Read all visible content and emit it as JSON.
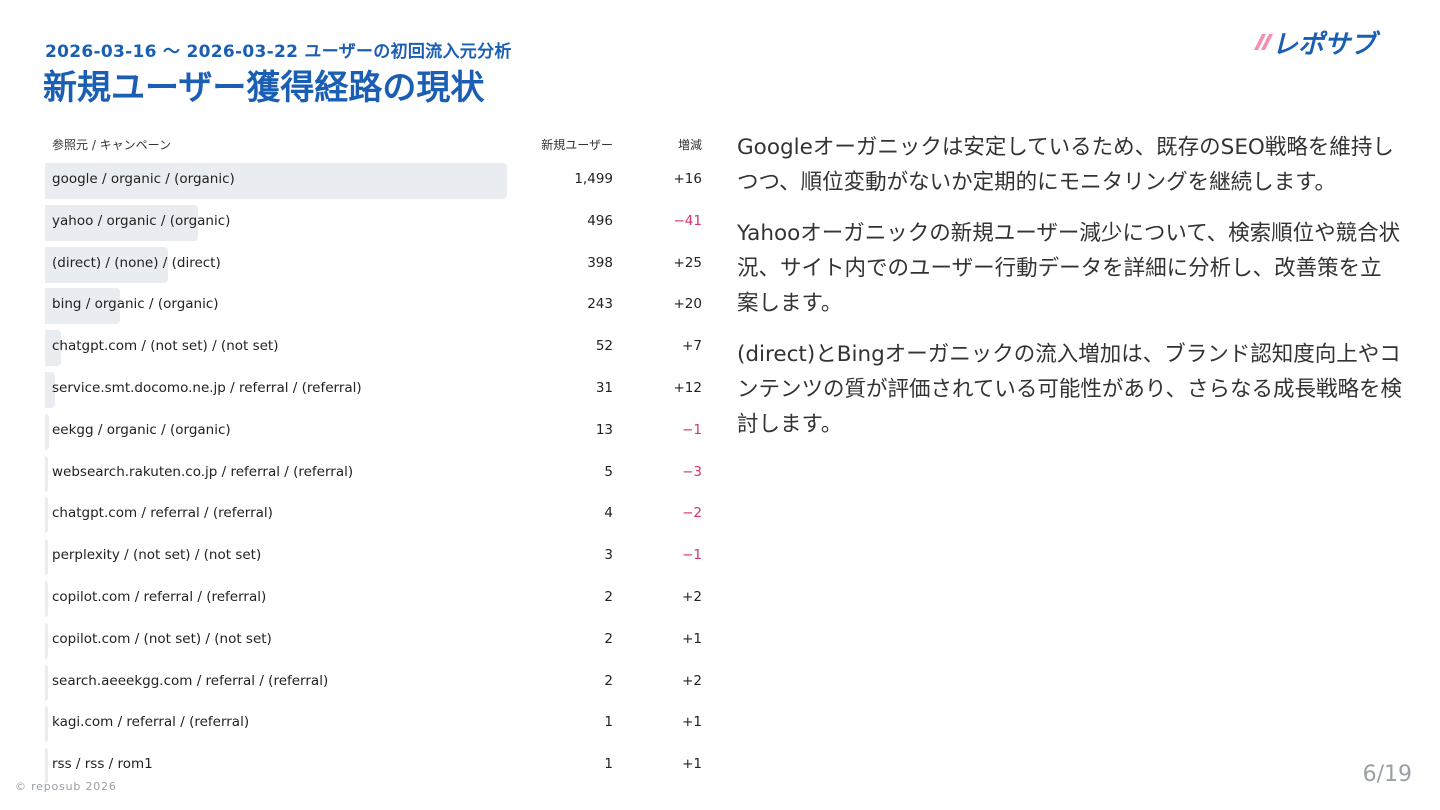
{
  "header": {
    "subtitle": "2026-03-16 〜 2026-03-22 ユーザーの初回流入元分析",
    "title": "新規ユーザー獲得経路の現状",
    "logo_text": "レポサブ",
    "logo_icon": "reposub-logo-icon",
    "accent_color": "#1a5fb4",
    "logo_color": "#1a5fb4",
    "logo_stripe_color": "#f48fb1"
  },
  "table": {
    "columns": {
      "referrer": "参照元 / キャンペーン",
      "new_users": "新規ユーザー",
      "change": "増減"
    },
    "bar_color": "#e9ecf0",
    "negative_color": "#d6336c",
    "rows": [
      {
        "label": "google / organic / (organic)",
        "users": "1,499",
        "users_value": 1499,
        "diff": "+16",
        "negative": false
      },
      {
        "label": "yahoo / organic / (organic)",
        "users": "496",
        "users_value": 496,
        "diff": "−41",
        "negative": true
      },
      {
        "label": "(direct) / (none) / (direct)",
        "users": "398",
        "users_value": 398,
        "diff": "+25",
        "negative": false
      },
      {
        "label": "bing / organic / (organic)",
        "users": "243",
        "users_value": 243,
        "diff": "+20",
        "negative": false
      },
      {
        "label": "chatgpt.com / (not set) / (not set)",
        "users": "52",
        "users_value": 52,
        "diff": "+7",
        "negative": false
      },
      {
        "label": "service.smt.docomo.ne.jp / referral / (referral)",
        "users": "31",
        "users_value": 31,
        "diff": "+12",
        "negative": false
      },
      {
        "label": "eekgg / organic / (organic)",
        "users": "13",
        "users_value": 13,
        "diff": "−1",
        "negative": true
      },
      {
        "label": "websearch.rakuten.co.jp / referral / (referral)",
        "users": "5",
        "users_value": 5,
        "diff": "−3",
        "negative": true
      },
      {
        "label": "chatgpt.com / referral / (referral)",
        "users": "4",
        "users_value": 4,
        "diff": "−2",
        "negative": true
      },
      {
        "label": "perplexity / (not set) / (not set)",
        "users": "3",
        "users_value": 3,
        "diff": "−1",
        "negative": true
      },
      {
        "label": "copilot.com / referral / (referral)",
        "users": "2",
        "users_value": 2,
        "diff": "+2",
        "negative": false
      },
      {
        "label": "copilot.com / (not set) / (not set)",
        "users": "2",
        "users_value": 2,
        "diff": "+1",
        "negative": false
      },
      {
        "label": "search.aeeekgg.com / referral / (referral)",
        "users": "2",
        "users_value": 2,
        "diff": "+2",
        "negative": false
      },
      {
        "label": "kagi.com / referral / (referral)",
        "users": "1",
        "users_value": 1,
        "diff": "+1",
        "negative": false
      },
      {
        "label": "rss / rss / rom1",
        "users": "1",
        "users_value": 1,
        "diff": "+1",
        "negative": false
      }
    ]
  },
  "commentary": {
    "p1": "Googleオーガニックは安定しているため、既存のSEO戦略を維持しつつ、順位変動がないか定期的にモニタリングを継続します。",
    "p2": "Yahooオーガニックの新規ユーザー減少について、検索順位や競合状況、サイト内でのユーザー行動データを詳細に分析し、改善策を立案します。",
    "p3": "(direct)とBingオーガニックの流入増加は、ブランド認知度向上やコンテンツの質が評価されている可能性があり、さらなる成長戦略を検討します。"
  },
  "footer": {
    "copyright": "© reposub 2026",
    "page": "6/19"
  }
}
